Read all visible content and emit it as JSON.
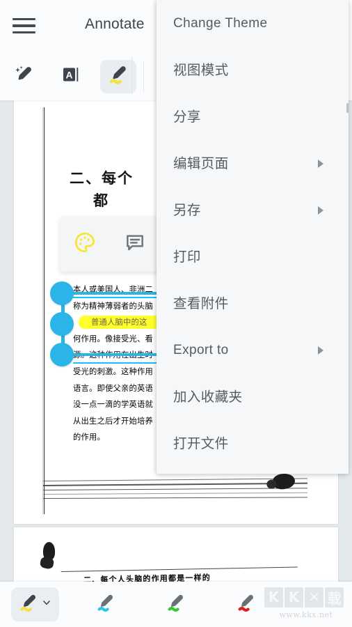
{
  "app": {
    "title": "Annotate",
    "menu_icon": "hamburger-icon"
  },
  "toolbar": {
    "tools": [
      {
        "name": "magic-pen-icon",
        "label": "Magic Pen"
      },
      {
        "name": "text-highlight-icon",
        "label": "A"
      },
      {
        "name": "highlighter-pen-icon",
        "label": "Highlighter",
        "selected": true
      }
    ]
  },
  "menu": {
    "items": [
      {
        "label": "Change Theme",
        "lang": "en",
        "submenu": false
      },
      {
        "label": "视图模式",
        "lang": "cn",
        "submenu": false
      },
      {
        "label": "分享",
        "lang": "cn",
        "submenu": false
      },
      {
        "label": "编辑页面",
        "lang": "cn",
        "submenu": true
      },
      {
        "label": "另存",
        "lang": "cn",
        "submenu": true
      },
      {
        "label": "打印",
        "lang": "cn",
        "submenu": false
      },
      {
        "label": "查看附件",
        "lang": "cn",
        "submenu": false
      },
      {
        "label": "Export to",
        "lang": "en",
        "submenu": true
      },
      {
        "label": "加入收藏夹",
        "lang": "cn",
        "submenu": false
      },
      {
        "label": "打开文件",
        "lang": "cn",
        "submenu": false
      }
    ]
  },
  "annotation_popup": {
    "buttons": [
      {
        "name": "color-palette-icon",
        "label": "Color",
        "color": "#f7e62e"
      },
      {
        "name": "comment-note-icon",
        "label": "Note",
        "color": "#6b727a"
      }
    ]
  },
  "document": {
    "heading_line1": "二、每个",
    "heading_line2": "都",
    "body_lines": [
      "本人或美国人、非洲二",
      "称为精神薄弱者的头脑",
      "普通人脑中的这",
      "何作用。像接受光、看",
      "源。这种作用在出生时",
      "受光的刺激。这种作用",
      "语言。即使父亲的英语",
      "没一点一滴的学英语就",
      "从出生之后才开始培养",
      "的作用。"
    ],
    "highlighted_line_index": 2,
    "page2_text": "二、每个人头脑的作用都是一样的",
    "selection_handles": 3
  },
  "bottom_toolbar": {
    "pens": [
      {
        "name": "highlighter-yellow",
        "color": "#f5e13b",
        "active": true,
        "has_dropdown": true
      },
      {
        "name": "highlighter-cyan",
        "color": "#2cc6e8",
        "active": false,
        "has_dropdown": false
      },
      {
        "name": "highlighter-green",
        "color": "#2fcc2f",
        "active": false,
        "has_dropdown": false
      },
      {
        "name": "highlighter-red",
        "color": "#e02020",
        "active": false,
        "has_dropdown": false
      }
    ]
  },
  "watermark": {
    "logo_k1": "K",
    "logo_k2": "K",
    "logo_x": "✕",
    "logo_cn": "载",
    "url": "www.kkx.net"
  },
  "colors": {
    "accent_selection": "#2ab4e8",
    "highlight_yellow": "#f7ec3d",
    "app_bg": "#e4e9ec",
    "bar_bg": "#fbfcfd",
    "menu_bg": "#f6f7f9",
    "menu_text": "#545b63"
  }
}
